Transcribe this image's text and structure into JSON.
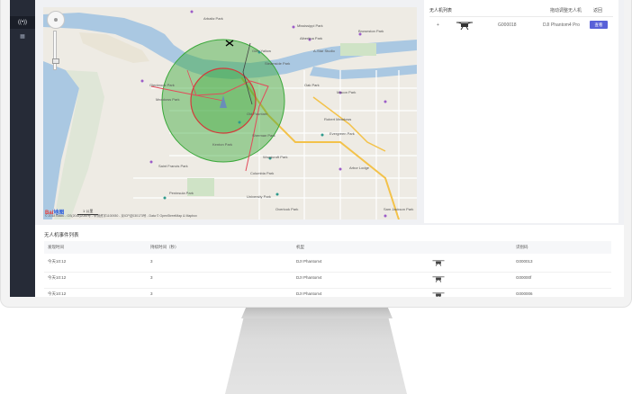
{
  "sidebar": {
    "items": [
      {
        "icon": "drone-icon"
      },
      {
        "icon": "grid-icon"
      }
    ]
  },
  "map": {
    "pois": [
      "Arbaitz Park",
      "Mississippi Park",
      "Brownston Park",
      "Albertina Park",
      "A-Star Studio",
      "Glen Yallow",
      "Steamside Park",
      "Oak Park",
      "Macon Park",
      "Glenbrook Park",
      "Meadows Park",
      "Old Fountain",
      "Robert Meadows",
      "Evergreen Park",
      "Sherman Park",
      "Kenton Park",
      "Woodcroft Park",
      "Arbor Lodge",
      "Saint Francis Park",
      "Columbia Park",
      "Peninsula Park",
      "University Park",
      "Overlook Park",
      "Sam Jackson Park"
    ],
    "logo_part1": "Bai",
    "logo_part2": "地图",
    "scale": "1 公里",
    "copyright": "© 2018 Baidu - GS(2016)2089号 - 甲测资字1100930 - 京ICP证030173号 - Data © OpenStreetMap & Mapbox"
  },
  "drone_panel": {
    "title": "无人机列表",
    "hint": "拖动调整无人机",
    "back": "返回",
    "rows": [
      {
        "expand": "+",
        "serial": "G000018",
        "model": "DJI Phantom4 Pro",
        "button": "查看"
      }
    ]
  },
  "events": {
    "title": "无人机事件列表",
    "columns": [
      "发现时间",
      "持续时间（秒）",
      "机型",
      "",
      "识别码"
    ],
    "rows": [
      {
        "time": "今天10:12",
        "duration": "3",
        "model": "DJI Phantom4",
        "id": "G000013"
      },
      {
        "time": "今天10:12",
        "duration": "3",
        "model": "DJI Phantom4",
        "id": "G00000f"
      },
      {
        "time": "今天10:12",
        "duration": "3",
        "model": "DJI Phantom4",
        "id": "G000006"
      }
    ]
  },
  "colors": {
    "accent": "#5961d8",
    "sidebar": "#262b37",
    "river": "#aac8e2",
    "zone_outer": "#3aa83a",
    "zone_inner": "#d33b3b"
  }
}
